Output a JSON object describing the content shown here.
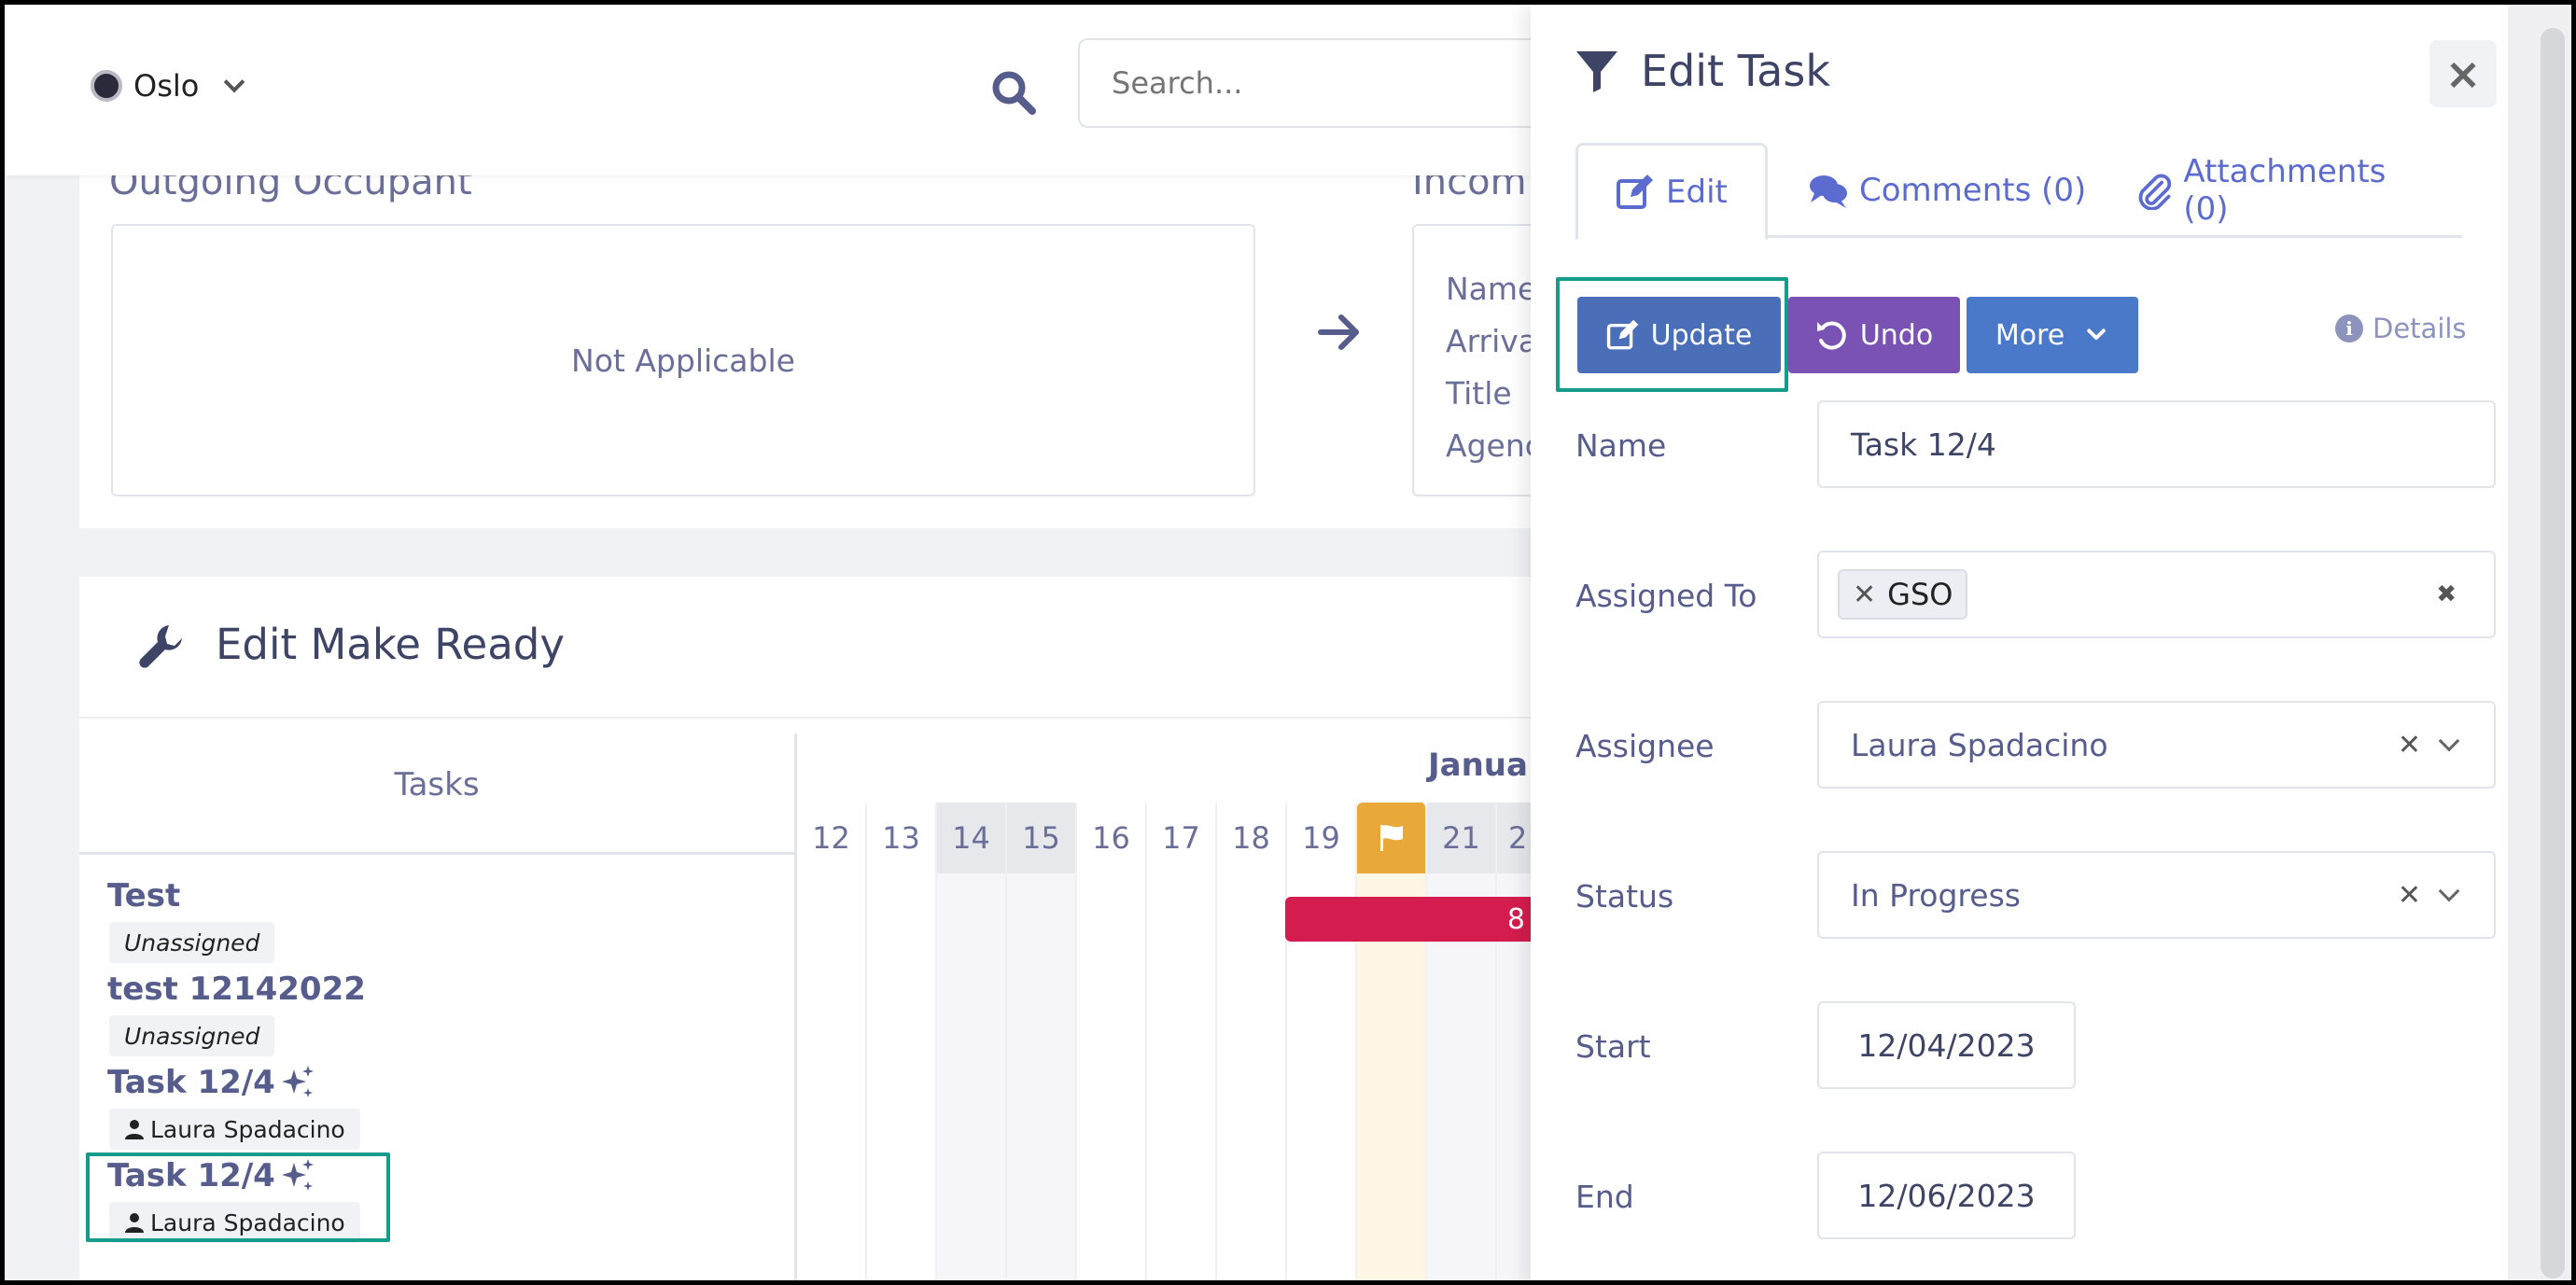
{
  "header": {
    "location": "Oslo",
    "search_placeholder": "Search..."
  },
  "occupants": {
    "outgoing_title": "Outgoing Occupant",
    "outgoing_value": "Not Applicable",
    "incoming_title": "Incom",
    "incoming_fields": [
      "Name",
      "Arriva",
      "Title",
      "Agenc"
    ]
  },
  "make_ready": {
    "title": "Edit Make Ready",
    "tasks_header": "Tasks",
    "month_label": "Janua",
    "days": [
      "12",
      "13",
      "14",
      "15",
      "16",
      "17",
      "18",
      "19",
      "",
      "21",
      "2"
    ],
    "bar_label": "8",
    "tasks": [
      {
        "name": "Test",
        "assignee": "Unassigned"
      },
      {
        "name": "test 12142022",
        "assignee": "Unassigned"
      },
      {
        "name": "Task 12/4",
        "assignee": "Laura Spadacino"
      },
      {
        "name": "Task 12/4",
        "assignee": "Laura Spadacino"
      }
    ]
  },
  "panel": {
    "title": "Edit Task",
    "close_label": "×",
    "tabs": {
      "edit": "Edit",
      "comments": "Comments (0)",
      "attachments": "Attachments (0)"
    },
    "buttons": {
      "update": "Update",
      "undo": "Undo",
      "more": "More",
      "details": "Details"
    },
    "fields": {
      "name_label": "Name",
      "name_value": "Task 12/4",
      "assigned_to_label": "Assigned To",
      "assigned_to_chip": "GSO",
      "assignee_label": "Assignee",
      "assignee_value": "Laura Spadacino",
      "status_label": "Status",
      "status_value": "In Progress",
      "start_label": "Start",
      "start_value": "12/04/2023",
      "end_label": "End",
      "end_value": "12/06/2023"
    }
  },
  "colors": {
    "accent": "#4a6fb8",
    "undo": "#7952b3",
    "today": "#e8a93a",
    "bar": "#d41d4e",
    "highlight": "#169c8c"
  }
}
